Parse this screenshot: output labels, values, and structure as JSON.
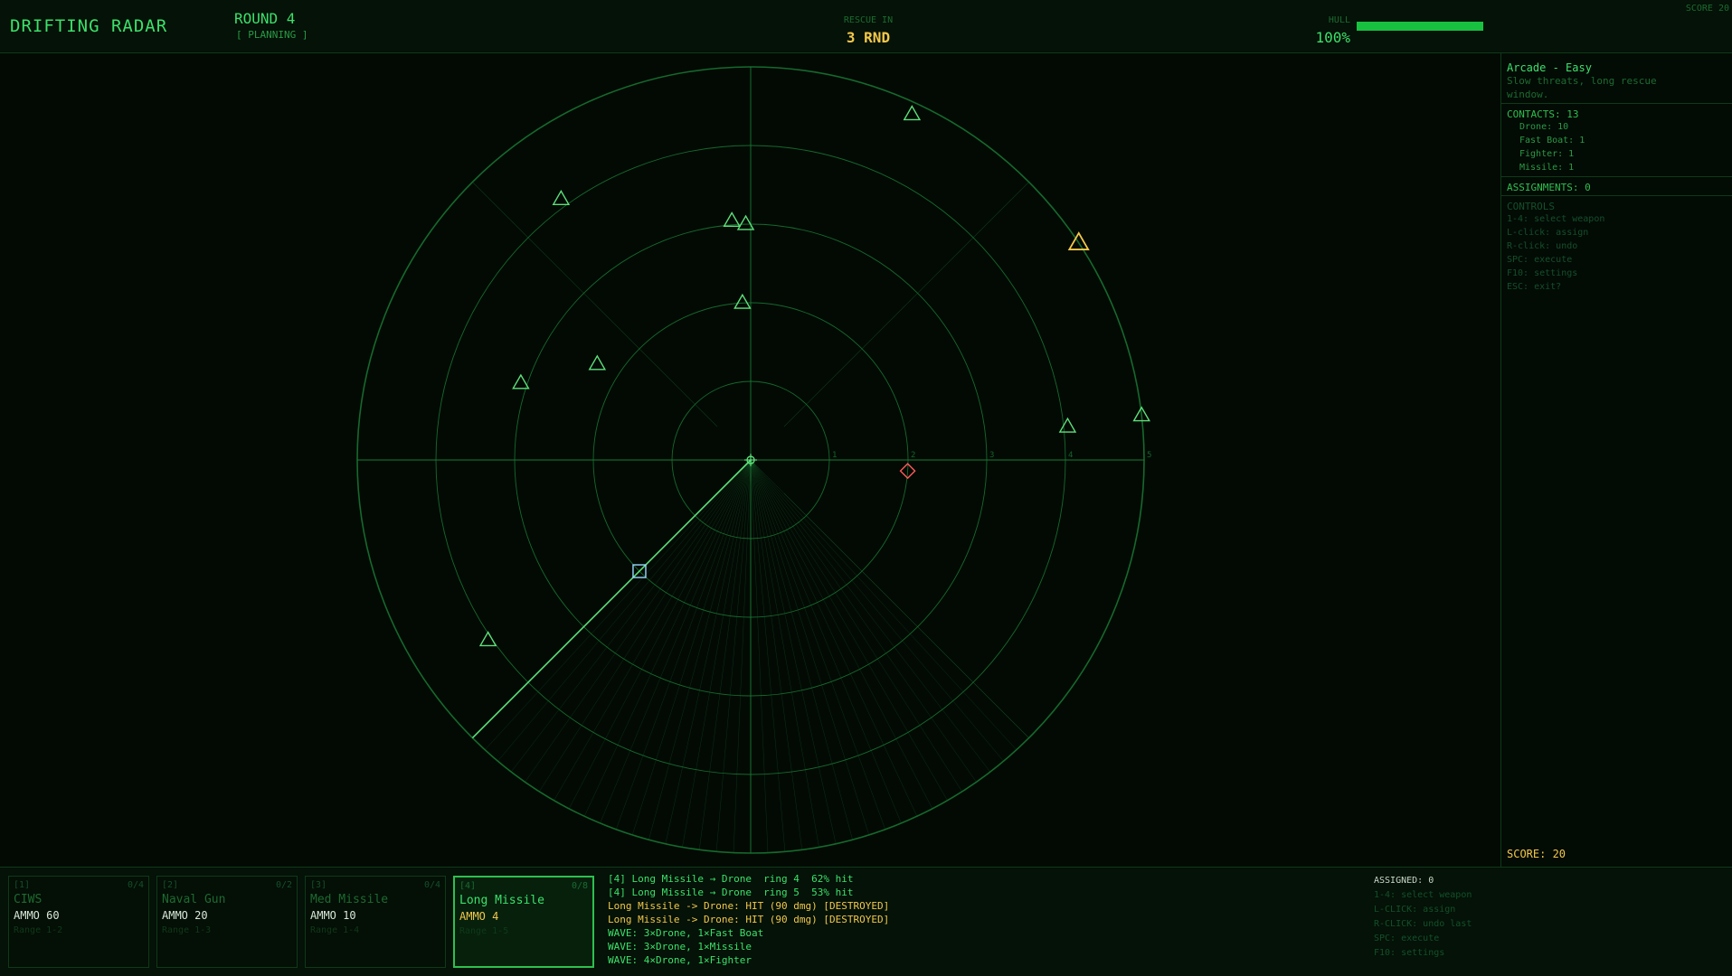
{
  "header": {
    "title": "DRIFTING RADAR",
    "round": "ROUND 4",
    "phase": "[ PLANNING ]",
    "rescue_caption": "RESCUE IN",
    "rescue_value": "3 RND",
    "hull_caption": "HULL",
    "hull_value": "100%",
    "hull_fraction": 1.0,
    "score_corner": "SCORE 20"
  },
  "colors": {
    "grid": "#1a7a34",
    "friendly": "#5ee07a",
    "selected_contact": "#f2c84b",
    "hostile_marker": "#ff5a5a",
    "cursor": "#9ad8ff",
    "hull_bar": "#18c240"
  },
  "radar": {
    "ring_labels": [
      "1",
      "2",
      "3",
      "4",
      "5"
    ],
    "ring_count": 5,
    "center_icon": "ship-icon",
    "aim_bearing_deg": 225,
    "aim_cursor_range": 2.0,
    "cone_from_deg": 135,
    "cone_to_deg": 225,
    "contacts": [
      {
        "type": "triangle",
        "bearing": 25,
        "range": 4.85,
        "state": "normal"
      },
      {
        "type": "triangle",
        "bearing": 324,
        "range": 4.1,
        "state": "normal"
      },
      {
        "type": "triangle",
        "bearing": 355.5,
        "range": 3.05,
        "state": "normal"
      },
      {
        "type": "triangle",
        "bearing": 358.8,
        "range": 3.0,
        "state": "normal"
      },
      {
        "type": "triangle",
        "bearing": 357,
        "range": 2.0,
        "state": "normal"
      },
      {
        "type": "triangle",
        "bearing": 302,
        "range": 2.3,
        "state": "normal"
      },
      {
        "type": "triangle",
        "bearing": 288.5,
        "range": 3.08,
        "state": "normal"
      },
      {
        "type": "triangle",
        "bearing": 235.5,
        "range": 4.05,
        "state": "normal"
      },
      {
        "type": "triangle",
        "bearing": 84,
        "range": 4.05,
        "state": "normal"
      },
      {
        "type": "triangle",
        "bearing": 83.5,
        "range": 5.0,
        "state": "normal"
      },
      {
        "type": "triangle",
        "bearing": 56.5,
        "range": 5.0,
        "state": "selected"
      },
      {
        "type": "diamond",
        "bearing": 94,
        "range": 2.0,
        "state": "hostile"
      }
    ]
  },
  "side_panel": {
    "mode_title": "Arcade - Easy",
    "mode_desc": "Slow threats, long rescue window.",
    "contacts_head": "CONTACTS: 13",
    "contacts": [
      "Drone: 10",
      "Fast Boat: 1",
      "Fighter: 1",
      "Missile: 1"
    ],
    "assignments_head": "ASSIGNMENTS: 0",
    "controls_head": "CONTROLS",
    "controls": [
      "1-4: select weapon",
      "L-click: assign",
      "R-click: undo",
      "SPC: execute",
      "F10: settings",
      "ESC: exit?"
    ],
    "score": "SCORE: 20"
  },
  "weapons": [
    {
      "key": "[1]",
      "name": "CIWS",
      "ammo": "AMMO 60",
      "range": "Range 1-2",
      "count": "0/4",
      "selected": false
    },
    {
      "key": "[2]",
      "name": "Naval Gun",
      "ammo": "AMMO 20",
      "range": "Range 1-3",
      "count": "0/2",
      "selected": false
    },
    {
      "key": "[3]",
      "name": "Med Missile",
      "ammo": "AMMO 10",
      "range": "Range 1-4",
      "count": "0/4",
      "selected": false
    },
    {
      "key": "[4]",
      "name": "Long Missile",
      "ammo": "AMMO 4",
      "range": "Range 1-5",
      "count": "0/8",
      "selected": true
    }
  ],
  "log": [
    {
      "text": "[4] Long Missile → Drone  ring 4  62% hit",
      "kind": "info"
    },
    {
      "text": "[4] Long Missile → Drone  ring 5  53% hit",
      "kind": "info"
    },
    {
      "text": "Long Missile -> Drone: HIT (90 dmg) [DESTROYED]",
      "kind": "hit"
    },
    {
      "text": "Long Missile -> Drone: HIT (90 dmg) [DESTROYED]",
      "kind": "hit"
    },
    {
      "text": "WAVE: 3×Drone, 1×Fast Boat",
      "kind": "info"
    },
    {
      "text": "WAVE: 3×Drone, 1×Missile",
      "kind": "info"
    },
    {
      "text": "WAVE: 4×Drone, 1×Fighter",
      "kind": "info"
    }
  ],
  "help": {
    "assigned": "ASSIGNED: 0",
    "lines": [
      "1-4: select weapon",
      "L-CLICK: assign",
      "R-CLICK: undo last",
      "SPC: execute",
      "F10: settings"
    ]
  }
}
